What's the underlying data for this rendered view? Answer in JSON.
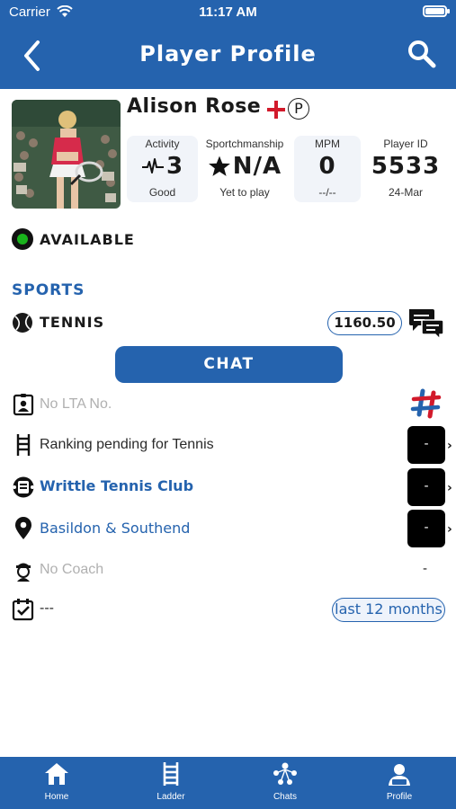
{
  "status_bar": {
    "carrier": "Carrier",
    "time": "11:17 AM"
  },
  "nav": {
    "title": "Player Profile",
    "back_icon": "chevron-left-icon",
    "search_icon": "search-icon"
  },
  "player": {
    "name": "Alison Rose",
    "pro_badge": "P",
    "stats": [
      {
        "label": "Activity",
        "value": "3",
        "sub": "Good",
        "icon": "pulse-icon"
      },
      {
        "label": "Sportchmanship",
        "value": "N/A",
        "sub": "Yet to play",
        "icon": "star-icon"
      },
      {
        "label": "MPM",
        "value": "0",
        "sub": "--/--"
      },
      {
        "label": "Player ID",
        "value": "5533",
        "sub": "24-Mar"
      }
    ]
  },
  "availability": {
    "status": "AVAILABLE",
    "color": "#19b31c"
  },
  "sports": {
    "title": "SPORTS",
    "sport_name": "TENNIS",
    "rating": "1160.50",
    "chat_label": "CHAT"
  },
  "details": {
    "lta": "No LTA No.",
    "ranking": "Ranking pending for Tennis",
    "club": "Writtle Tennis Club",
    "region": "Basildon & Southend",
    "coach": "No Coach",
    "coach_value": "-",
    "results": "---",
    "period": "last 12 months",
    "button_label": "-"
  },
  "tabs": [
    {
      "label": "Home",
      "icon": "home-icon"
    },
    {
      "label": "Ladder",
      "icon": "ladder-icon"
    },
    {
      "label": "Chats",
      "icon": "chats-icon"
    },
    {
      "label": "Profile",
      "icon": "profile-icon"
    }
  ],
  "colors": {
    "brand": "#2563ae",
    "available": "#19b31c"
  }
}
